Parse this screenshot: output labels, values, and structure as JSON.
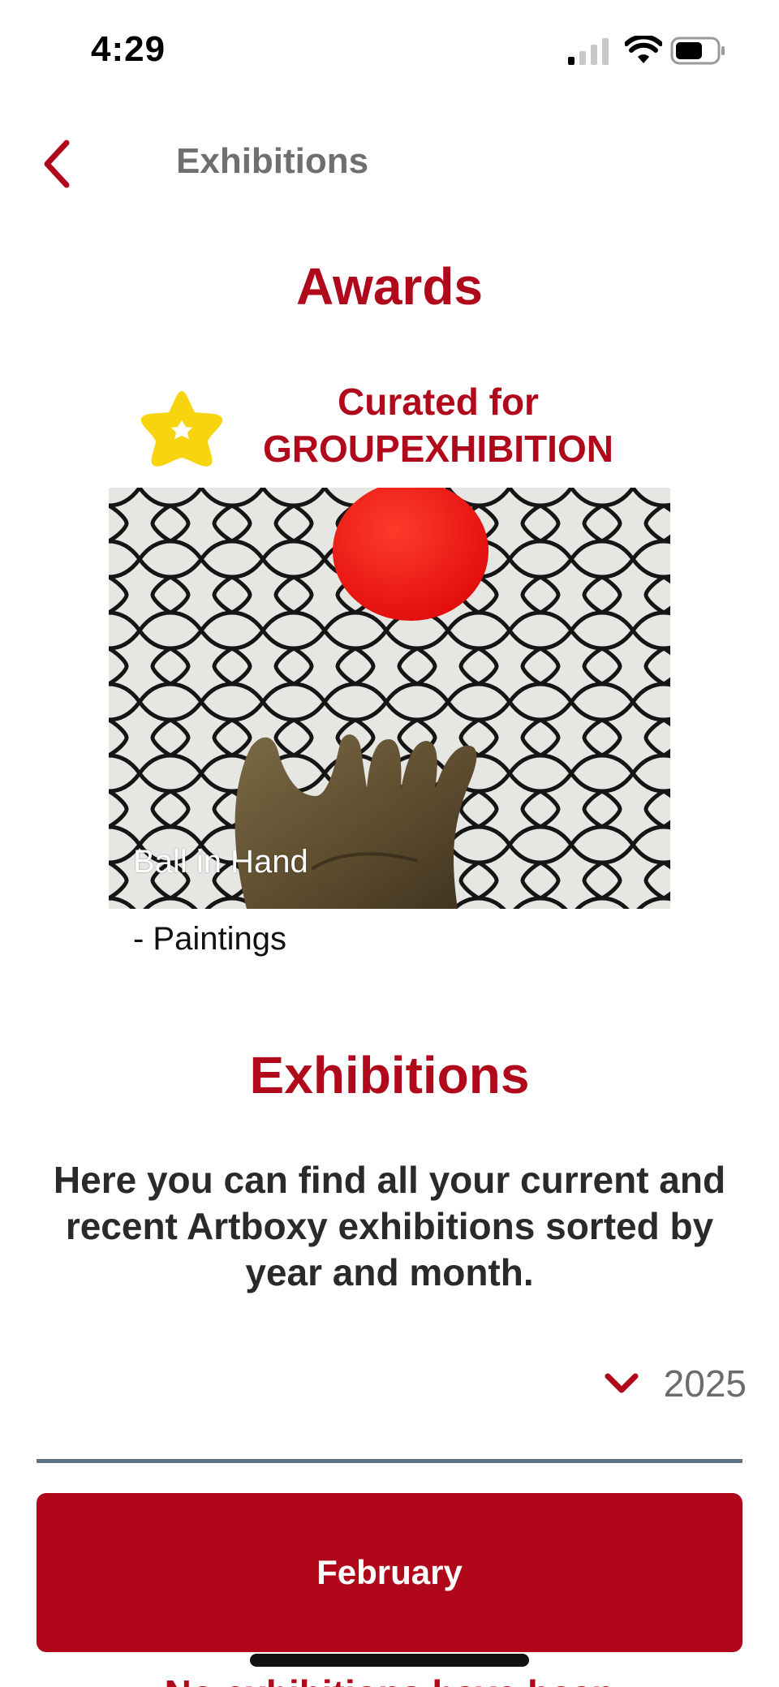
{
  "status_bar": {
    "time": "4:29",
    "icons": [
      "signal-icon",
      "wifi-icon",
      "battery-icon"
    ]
  },
  "header": {
    "back_icon": "chevron-left-icon",
    "title": "Exhibitions"
  },
  "awards": {
    "section_title": "Awards",
    "badge_icon": "star-icon",
    "award_line1": "Curated for",
    "award_line2": "GROUPEXHIBITION",
    "artwork_title": "Ball in Hand",
    "artwork_category": "- Paintings"
  },
  "exhibitions": {
    "section_title": "Exhibitions",
    "intro": "Here you can find all your current and recent Artboxy exhibitions sorted by year and month.",
    "year": "2025",
    "month": "February",
    "partial_text": "No exhibitions have been"
  },
  "colors": {
    "accent": "#b0091b",
    "button": "#b0071a",
    "star": "#f8d40f",
    "divider": "#5f7383"
  }
}
